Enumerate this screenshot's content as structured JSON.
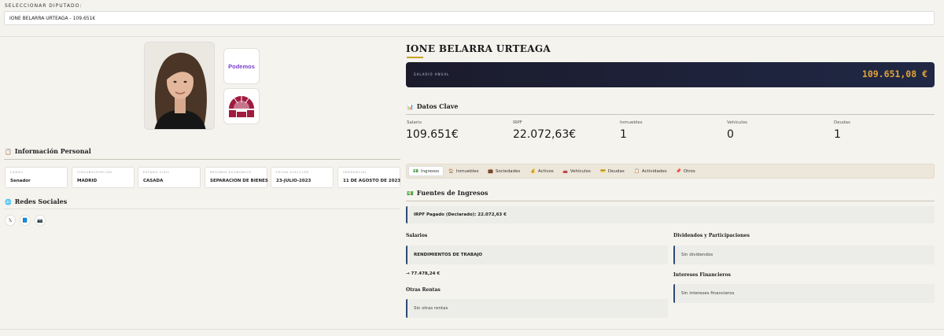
{
  "selector": {
    "label": "SELECCIONAR DIPUTADO:",
    "value": "IONE BELARRA URTEAGA - 109.651€"
  },
  "profile": {
    "party_logo_text": "Podemos",
    "name": "IONE BELARRA URTEAGA",
    "salary_label": "SALARIO ANUAL",
    "salary_value": "109.651,08 €"
  },
  "personal_info": {
    "title": "Información Personal",
    "icon": "📋",
    "cards": [
      {
        "label": "CARGO",
        "value": "Senador"
      },
      {
        "label": "CIRCUNSCRIPCIÓN",
        "value": "MADRID"
      },
      {
        "label": "ESTADO CIVIL",
        "value": "CASADA"
      },
      {
        "label": "RÉGIMEN ECONÓMICO",
        "value": "SEPARACION DE BIENES"
      },
      {
        "label": "FECHA ELECCIÓN",
        "value": "23-JULIO-2023"
      },
      {
        "label": "CREDENCIAL",
        "value": "11 DE AGOSTO DE 2023"
      }
    ]
  },
  "social": {
    "title": "Redes Sociales",
    "icon": "🌐",
    "items": [
      "𝕏",
      "📘",
      "📷"
    ]
  },
  "key_data": {
    "title": "Datos Clave",
    "icon": "📊",
    "items": [
      {
        "label": "Salario",
        "value": "109.651€"
      },
      {
        "label": "IRPF",
        "value": "22.072,63€"
      },
      {
        "label": "Inmuebles",
        "value": "1"
      },
      {
        "label": "Vehículos",
        "value": "0"
      },
      {
        "label": "Deudas",
        "value": "1"
      }
    ]
  },
  "tabs": [
    {
      "icon": "💵",
      "label": "Ingresos"
    },
    {
      "icon": "🏠",
      "label": "Inmuebles"
    },
    {
      "icon": "💼",
      "label": "Sociedades"
    },
    {
      "icon": "💰",
      "label": "Activos"
    },
    {
      "icon": "🚗",
      "label": "Vehículos"
    },
    {
      "icon": "💳",
      "label": "Deudas"
    },
    {
      "icon": "📋",
      "label": "Actividades"
    },
    {
      "icon": "📌",
      "label": "Otros"
    }
  ],
  "income": {
    "title": "Fuentes de Ingresos",
    "icon": "💵",
    "irpf_note": "IRPF Pagado (Declarado): 22.072,63 €",
    "salaries_title": "Salarios",
    "salary_item": "RENDIMIENTOS DE TRABAJO",
    "salary_amount": "→ 77.478,24 €",
    "other_title": "Otras Rentas",
    "other_value": "Sin otras rentas",
    "dividends_title": "Dividendos y Participaciones",
    "dividends_value": "Sin dividendos",
    "interest_title": "Intereses Financieros",
    "interest_value": "Sin intereses financieros"
  },
  "colors": {
    "accent_gold": "#c9a227",
    "salary_bar": "#1b1b2c",
    "salary_text": "#e0a33a",
    "podemos_purple": "#7b3fd1",
    "note_border": "#2d4a75"
  }
}
